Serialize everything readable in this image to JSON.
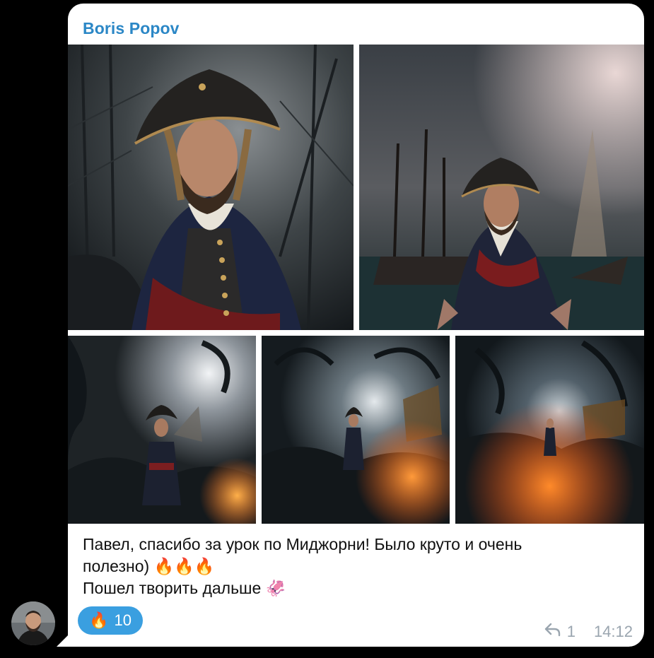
{
  "message": {
    "sender": "Boris Popov",
    "lines": [
      "Павел, спасибо за урок по Миджорни! Было круто и очень",
      "полезно) 🔥🔥🔥",
      "Пошел творить дальше 🦑"
    ],
    "reaction": {
      "emoji": "🔥",
      "count": "10"
    },
    "replies": "1",
    "time": "14:12"
  },
  "icons": {
    "reply": "reply-arrow-icon",
    "fire": "fire-emoji",
    "squid": "squid-emoji"
  },
  "colors": {
    "sender": "#2b87c6",
    "reaction_bg": "#3a9fe0",
    "meta": "#9aa5af",
    "background": "#000000"
  }
}
